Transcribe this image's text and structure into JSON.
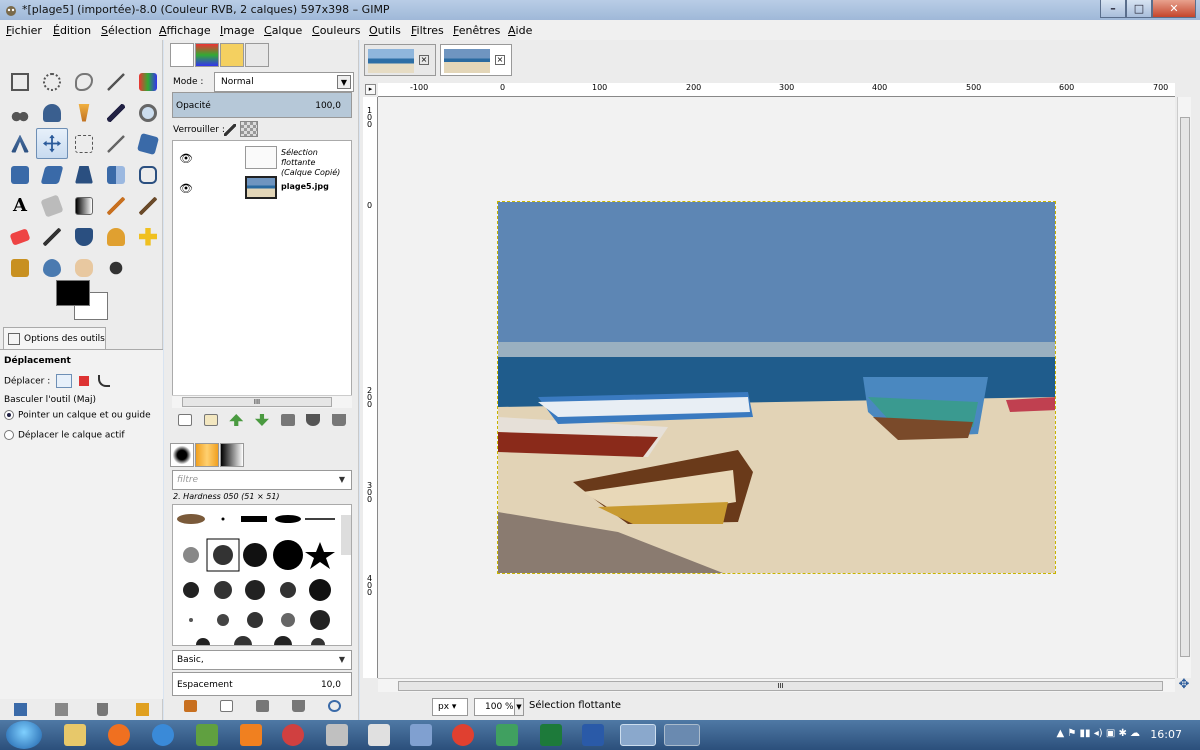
{
  "window": {
    "title": "*[plage5] (importée)-8.0 (Couleur RVB, 2 calques) 597x398 – GIMP",
    "buttons": {
      "minimize": "–",
      "maximize": "□",
      "close": "✕"
    }
  },
  "menu": [
    "Fichier",
    "Édition",
    "Sélection",
    "Affichage",
    "Image",
    "Calque",
    "Couleurs",
    "Outils",
    "Filtres",
    "Fenêtres",
    "Aide"
  ],
  "tool_options": {
    "tab_label": "Options des outils",
    "heading": "Déplacement",
    "move_label": "Déplacer :",
    "toggle_label": "Basculer l'outil  (Maj)",
    "radio1": "Pointer un calque et ou guide",
    "radio2": "Déplacer le calque actif"
  },
  "layers": {
    "mode_label": "Mode :",
    "mode_value": "Normal",
    "opacity_label": "Opacité",
    "opacity_value": "100,0",
    "lock_label": "Verrouiller :",
    "items": [
      {
        "name_line1": "Sélection flottante",
        "name_line2": "(Calque Copié)"
      },
      {
        "name_line1": "plage5.jpg"
      }
    ]
  },
  "brushes": {
    "filter_placeholder": "filtre",
    "current_brush": "2. Hardness 050 (51 × 51)",
    "set_name": "Basic,",
    "spacing_label": "Espacement",
    "spacing_value": "10,0"
  },
  "ruler": {
    "h_ticks": [
      "-100",
      "0",
      "100",
      "200",
      "300",
      "400",
      "500",
      "600",
      "700"
    ],
    "v_ticks": [
      "100",
      "0",
      "200",
      "300",
      "400"
    ]
  },
  "scrollbar_grip": "III",
  "status": {
    "unit": "px",
    "zoom": "100 %",
    "text": "Sélection flottante"
  },
  "taskbar": {
    "clock": "16:07"
  },
  "colors": {
    "accent": "#c8b400",
    "titlebar": "#9fb8d8",
    "fg": "#000000",
    "bg": "#ffffff"
  }
}
